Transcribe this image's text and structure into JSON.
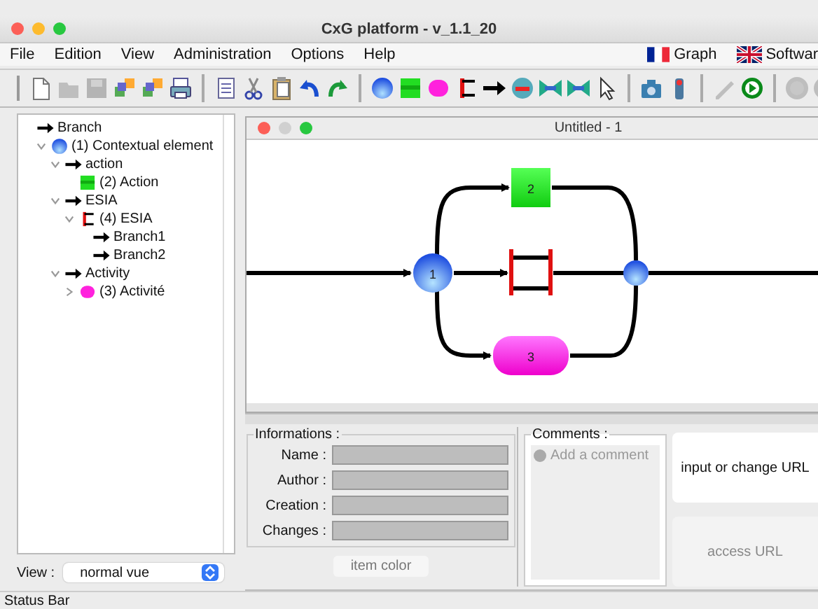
{
  "window": {
    "title": "CxG platform  - v_1.1_20"
  },
  "menu": [
    "File",
    "Edition",
    "View",
    "Administration",
    "Options",
    "Help"
  ],
  "languages": [
    {
      "label": "Graph",
      "kind": "fr"
    },
    {
      "label": "Softwar",
      "kind": "uk"
    }
  ],
  "toolbar": [
    {
      "kind": "new",
      "disabled": false
    },
    {
      "kind": "open",
      "disabled": true
    },
    {
      "kind": "save",
      "disabled": true
    },
    {
      "kind": "share",
      "disabled": false
    },
    {
      "kind": "share",
      "disabled": false
    },
    {
      "kind": "print",
      "disabled": false
    },
    {
      "kind": "sep"
    },
    {
      "kind": "text",
      "disabled": false
    },
    {
      "kind": "cut",
      "disabled": false
    },
    {
      "kind": "paste",
      "disabled": false
    },
    {
      "kind": "undo",
      "disabled": false
    },
    {
      "kind": "redo",
      "disabled": false
    },
    {
      "kind": "sep"
    },
    {
      "kind": "context",
      "disabled": false
    },
    {
      "kind": "action",
      "disabled": false
    },
    {
      "kind": "activity",
      "disabled": false
    },
    {
      "kind": "esia",
      "disabled": false
    },
    {
      "kind": "branch",
      "disabled": false
    },
    {
      "kind": "minus",
      "disabled": false
    },
    {
      "kind": "bowtie",
      "disabled": false
    },
    {
      "kind": "bowtie",
      "disabled": false
    },
    {
      "kind": "cursor",
      "disabled": false
    },
    {
      "kind": "sep"
    },
    {
      "kind": "camera",
      "disabled": false
    },
    {
      "kind": "meter",
      "disabled": false
    },
    {
      "kind": "sep"
    },
    {
      "kind": "pencil",
      "disabled": true
    },
    {
      "kind": "play",
      "disabled": false
    },
    {
      "kind": "sep"
    },
    {
      "kind": "disc",
      "disabled": true
    },
    {
      "kind": "disc",
      "disabled": true
    }
  ],
  "tree": [
    {
      "label": "Branch",
      "kind": "branch",
      "children": [
        {
          "label": "(1) Contextual element",
          "kind": "context",
          "expanded": true,
          "children": [
            {
              "label": "action",
              "kind": "branch",
              "expanded": true,
              "children": [
                {
                  "label": "(2) Action",
                  "kind": "action"
                }
              ]
            },
            {
              "label": "ESIA",
              "kind": "branch",
              "expanded": true,
              "children": [
                {
                  "label": "(4) ESIA",
                  "kind": "esia",
                  "expanded": true,
                  "children": [
                    {
                      "label": "Branch1",
                      "kind": "branch"
                    },
                    {
                      "label": "Branch2",
                      "kind": "branch"
                    }
                  ]
                }
              ]
            },
            {
              "label": "Activity",
              "kind": "branch",
              "expanded": true,
              "children": [
                {
                  "label": "(3) Activité",
                  "kind": "activity",
                  "expanded": false
                }
              ]
            }
          ]
        }
      ]
    }
  ],
  "view_selector": {
    "label": "View :",
    "value": "normal vue"
  },
  "document": {
    "title": "Untitled - 1",
    "nodes": [
      {
        "kind": "context",
        "label": "1"
      },
      {
        "kind": "action",
        "label": "2"
      },
      {
        "kind": "esia"
      },
      {
        "kind": "activity",
        "label": "3"
      },
      {
        "kind": "join"
      }
    ]
  },
  "informations": {
    "title": "Informations :",
    "fields": [
      {
        "label": "Name :"
      },
      {
        "label": "Author :"
      },
      {
        "label": "Creation :"
      },
      {
        "label": "Changes :"
      }
    ],
    "button": "item color"
  },
  "comments": {
    "title": "Comments :",
    "placeholder": "Add a comment"
  },
  "url_buttons": [
    {
      "label": "input or change URL",
      "disabled": false
    },
    {
      "label": "access URL",
      "disabled": true
    }
  ],
  "status_bar": "Status Bar"
}
